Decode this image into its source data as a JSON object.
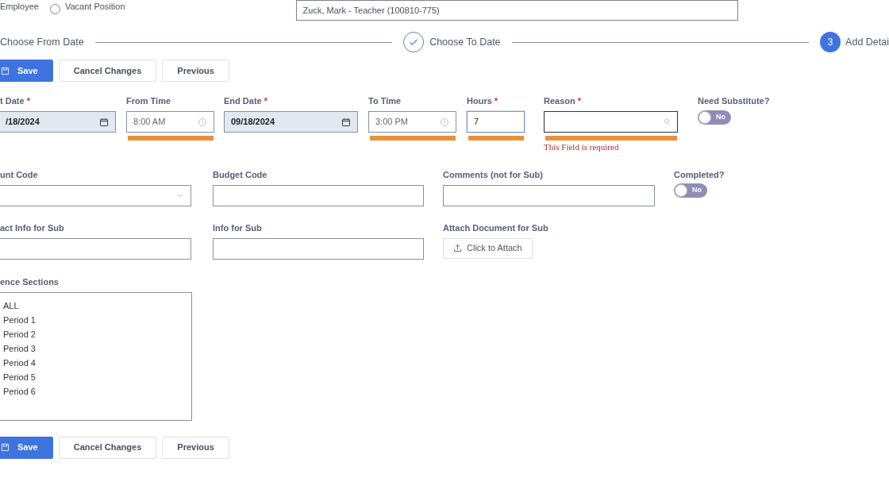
{
  "employee_type_label": "Employee",
  "vacant_position": {
    "label": "Vacant Position",
    "selected": false
  },
  "employee_field": {
    "value": "Zuck, Mark - Teacher (100810-775)"
  },
  "steps": [
    {
      "label": "Choose From Date",
      "kind": "plain"
    },
    {
      "label": "Choose To Date",
      "kind": "done"
    },
    {
      "label": "Add Detai",
      "kind": "current",
      "number": "3"
    }
  ],
  "actions_top": [
    "Save",
    "Cancel Changes",
    "Previous"
  ],
  "rows": [
    [
      {
        "kind": "date",
        "label": "t Date",
        "required_mark": "*",
        "value": "/18/2024"
      },
      {
        "kind": "time",
        "label": "From Time",
        "value": "8:00 AM",
        "highlighted": true
      },
      {
        "kind": "date",
        "label": "End Date",
        "required_mark": "*",
        "value": "09/18/2024"
      },
      {
        "kind": "time",
        "label": "To Time",
        "value": "3:00 PM",
        "highlighted": true
      },
      {
        "kind": "text",
        "label": "Hours",
        "required_mark": "*",
        "value": "7",
        "highlighted": true
      },
      {
        "kind": "search",
        "label": "Reason",
        "required_mark": "*",
        "highlighted": true,
        "error": "This Field is required"
      },
      {
        "kind": "toggle",
        "label": "Need Substitute?",
        "on": false,
        "state_label": "No"
      }
    ],
    [
      {
        "kind": "select",
        "label": "unt Code"
      },
      {
        "kind": "text",
        "label": "Budget Code"
      },
      {
        "kind": "text",
        "label": "Comments (not for Sub)"
      },
      {
        "kind": "toggle",
        "label": "Completed?",
        "on": false,
        "state_label": "No"
      }
    ],
    [
      {
        "kind": "text",
        "label": "act Info for Sub"
      },
      {
        "kind": "text",
        "label": "Info for Sub"
      },
      {
        "kind": "attach",
        "label": "Attach Document for Sub",
        "button": "Click to Attach"
      }
    ],
    [
      {
        "kind": "listbox",
        "label": "ence Sections",
        "options": [
          "ALL",
          "Period 1",
          "Period 2",
          "Period 3",
          "Period 4",
          "Period 5",
          "Period 6"
        ]
      }
    ]
  ],
  "actions_bottom": [
    "Save",
    "Cancel Changes",
    "Previous"
  ]
}
